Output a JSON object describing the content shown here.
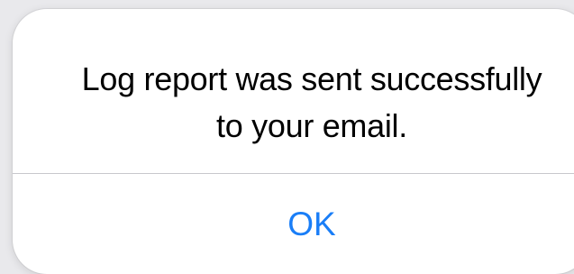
{
  "alert": {
    "message_line1": "Log report was sent successfully",
    "message_line2": "to your email.",
    "ok_label": "OK"
  },
  "colors": {
    "background": "#e9e9ec",
    "dialog": "#ffffff",
    "text": "#000000",
    "accent": "#1a7ef7",
    "divider": "#c8c8cc"
  }
}
